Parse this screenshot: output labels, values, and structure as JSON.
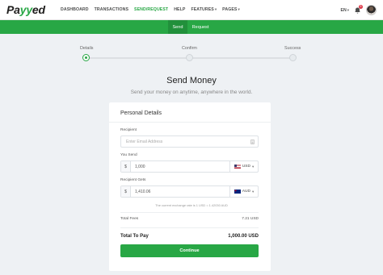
{
  "brand": {
    "logo_prefix": "Pa",
    "logo_accent": "yy",
    "logo_suffix": "ed",
    "accent_color": "#28a745"
  },
  "nav": {
    "items": [
      {
        "label": "DASHBOARD"
      },
      {
        "label": "TRANSACTIONS"
      },
      {
        "label": "SEND/REQUEST",
        "active": true
      },
      {
        "label": "HELP"
      },
      {
        "label": "FEATURES",
        "dropdown": true
      },
      {
        "label": "PAGES",
        "dropdown": true
      }
    ],
    "language": "EN",
    "notification_count": "5",
    "icons": [
      "bell-icon",
      "avatar"
    ]
  },
  "subnav": {
    "send_label": "Send",
    "request_label": "Request"
  },
  "steps": [
    {
      "label": "Details",
      "state": "active"
    },
    {
      "label": "Confirm",
      "state": "pending"
    },
    {
      "label": "Success",
      "state": "pending"
    }
  ],
  "page": {
    "title": "Send Money",
    "subtitle": "Send your money on anytime, anywhere in the world."
  },
  "form": {
    "card_title": "Personal Details",
    "recipient_label": "Recipient",
    "recipient_placeholder": "Enter Email Address",
    "you_send_label": "You Send",
    "you_send_prefix": "$",
    "you_send_value": "1,000",
    "you_send_currency": "USD",
    "recipient_gets_label": "Recipient Gets",
    "recipient_gets_prefix": "$",
    "recipient_gets_value": "1,410.06",
    "recipient_gets_currency": "AUD",
    "rate_note": "The current exchange rate is 1 USD = 1.42030 AUD",
    "fees_label": "Total Fees",
    "fees_value": "7.21 USD",
    "total_label": "Total To Pay",
    "total_value": "1,000.00 USD",
    "continue_label": "Continue"
  }
}
